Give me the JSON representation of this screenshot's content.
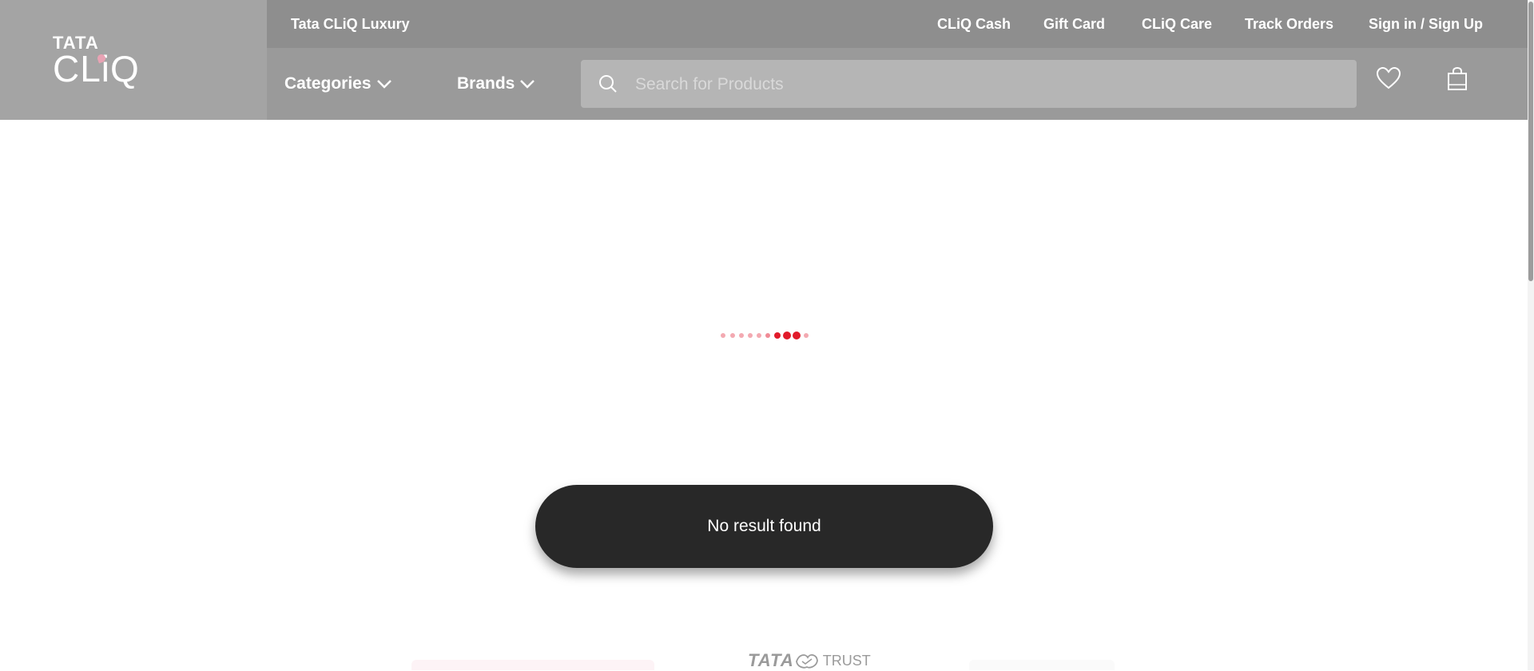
{
  "header": {
    "logo": {
      "line1": "TATA",
      "line2": "CLiQ"
    },
    "top_links": {
      "luxury": "Tata CLiQ Luxury",
      "cash": "CLiQ Cash",
      "gift": "Gift Card",
      "care": "CLiQ Care",
      "track": "Track Orders",
      "signin": "Sign in / Sign Up"
    },
    "nav": {
      "categories": "Categories",
      "brands": "Brands"
    },
    "search": {
      "placeholder": "Search for Products",
      "value": ""
    },
    "icons": [
      "search-icon",
      "heart-icon",
      "shopping-bag-icon",
      "chevron-down-icon"
    ]
  },
  "loader": {
    "active_color": "#e11b2b",
    "inactive_color": "#f0a6ae"
  },
  "toast": {
    "message": "No result found"
  },
  "footer": {
    "trust_brand": "TATA",
    "trust_label": "TRUST"
  },
  "colors": {
    "header_bg": "#9a9a9a",
    "topbar_bg": "#8e8e8e",
    "toast_bg": "#282828"
  }
}
